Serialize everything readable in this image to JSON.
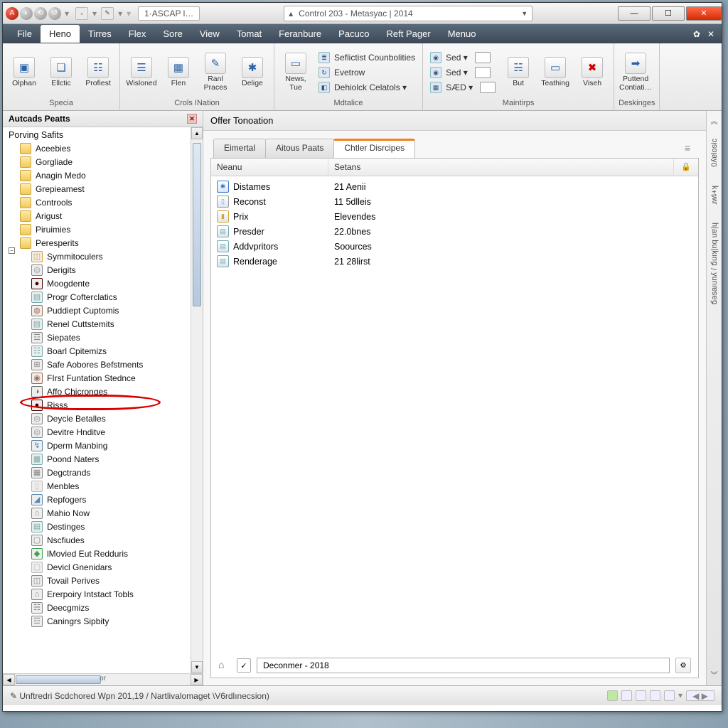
{
  "title_tab": "1·ASCAP l…",
  "combo_title": "Control 203 - Metasyac | 2014",
  "menubar": [
    "File",
    "Heno",
    "Tirres",
    "Flex",
    "Sore",
    "View",
    "Tomat",
    "Feranbure",
    "Pacuco",
    "Reft Pager",
    "Menuo"
  ],
  "menubar_active_index": 1,
  "ribbon_groups": [
    {
      "label": "Specia",
      "items": [
        {
          "l": "Olphan",
          "i": "▣"
        },
        {
          "l": "Ellctic",
          "i": "❏"
        },
        {
          "l": "Profiest",
          "i": "☷"
        }
      ]
    },
    {
      "label": "Crols INation",
      "items": [
        {
          "l": "Wisloned",
          "i": "☰"
        },
        {
          "l": "Flen",
          "i": "▦"
        },
        {
          "l": "Ranl Praces",
          "i": "✎"
        },
        {
          "l": "Delige",
          "i": "✱"
        }
      ]
    },
    {
      "label": "Mdtalice",
      "items": [
        {
          "l": "News,\nTue",
          "i": "▭"
        }
      ],
      "list": [
        {
          "l": "Seflictist Counbolities",
          "i": "≣"
        },
        {
          "l": "Evetrow",
          "i": "↻"
        },
        {
          "l": "Dehiolck Celatols ▾",
          "i": "◧"
        }
      ]
    },
    {
      "label": "Maintirps",
      "list2": [
        {
          "l": "Sed ▾",
          "i": "◉"
        },
        {
          "l": "Sed ▾",
          "i": "◉"
        },
        {
          "l": "SÆD ▾",
          "i": "▦"
        }
      ],
      "items": [
        {
          "l": "But",
          "i": "☵"
        },
        {
          "l": "Teathing",
          "i": "▭"
        },
        {
          "l": "Viseh",
          "i": "✖",
          "red": true
        }
      ]
    },
    {
      "label": "Deskinges",
      "items": [
        {
          "l": "Puttend\nContiati…",
          "i": "➡"
        }
      ]
    }
  ],
  "left_panel": {
    "title": "Autcads Peatts",
    "root": "Porving Safits",
    "folders": [
      "Aceebies",
      "Gorgliade",
      "Anagin Medo",
      "Grepieamest",
      "Controols",
      "Arigust",
      "Piruimies",
      "Peresperits"
    ],
    "subitems": [
      {
        "l": "Symmitoculers",
        "i": "◫",
        "c": "#d8a030"
      },
      {
        "l": "Derigits",
        "i": "◎",
        "c": "#888"
      },
      {
        "l": "Moogdente",
        "i": "●",
        "c": "#400"
      },
      {
        "l": "Progr Cofterclatics",
        "i": "▤",
        "c": "#7aa"
      },
      {
        "l": "Puddiept Cuptomis",
        "i": "◍",
        "c": "#a07050"
      },
      {
        "l": "Renel Cuttstemits",
        "i": "▤",
        "c": "#7aa"
      },
      {
        "l": "Siepates",
        "i": "☲",
        "c": "#888"
      },
      {
        "l": "Boarl Cpitemizs",
        "i": "☷",
        "c": "#7aa"
      },
      {
        "l": "Safe Aobores Befstments",
        "i": "⊞",
        "c": "#888"
      },
      {
        "l": "FIrst Funtation Stednce",
        "i": "◉",
        "c": "#a07050"
      },
      {
        "l": "Affo Chicronges",
        "i": "◑",
        "c": "#666"
      },
      {
        "l": "Risss",
        "i": "●",
        "c": "#400"
      },
      {
        "l": "Deycle Betalles",
        "i": "◎",
        "c": "#888"
      },
      {
        "l": "Devitre Hnditve",
        "i": "◎",
        "c": "#888"
      },
      {
        "l": "Dperm Manbing",
        "i": "↯",
        "c": "#5a88b0"
      },
      {
        "l": "Poond Naters",
        "i": "▦",
        "c": "#7aa"
      },
      {
        "l": "Degctrands",
        "i": "▦",
        "c": "#888"
      },
      {
        "l": "Menbles",
        "i": "▯",
        "c": "#bbb"
      },
      {
        "l": "Repfogers",
        "i": "◢",
        "c": "#5a88b0"
      },
      {
        "l": "Mahio Now",
        "i": "⌂",
        "c": "#888"
      },
      {
        "l": "Destinges",
        "i": "▤",
        "c": "#7aa"
      },
      {
        "l": "Nscfiudes",
        "i": "▢",
        "c": "#888"
      },
      {
        "l": "lMovied Eut Redduris",
        "i": "◆",
        "c": "#42a050"
      },
      {
        "l": "Devicl Gnenidars",
        "i": "▢",
        "c": "#bbb"
      },
      {
        "l": "Tovail Perives",
        "i": "◫",
        "c": "#888"
      },
      {
        "l": "Ererpoiry Intstact Tobls",
        "i": "⌂",
        "c": "#888"
      },
      {
        "l": "Deecgmizs",
        "i": "☵",
        "c": "#888"
      },
      {
        "l": "Caningrs Sipbity",
        "i": "☲",
        "c": "#888"
      }
    ],
    "hscroll_label": "or"
  },
  "main_header": "Offer Tonoation",
  "tabs": [
    {
      "l": "Eimertal"
    },
    {
      "l": "Aitous Paats"
    },
    {
      "l": "Chtler Disrcipes",
      "active": true
    }
  ],
  "columns": [
    "Neanu",
    "Setans"
  ],
  "rows": [
    {
      "n": "Distames",
      "v": "21 Aenii",
      "i": "✱",
      "c": "#3a78c8"
    },
    {
      "n": "Reconst",
      "v": "11 5dlleis",
      "i": "▯",
      "c": "#999"
    },
    {
      "n": "Prix",
      "v": "Elevendes",
      "i": "▮",
      "c": "#d8a030"
    },
    {
      "n": "Presder",
      "v": "22.0bnes",
      "i": "▤",
      "c": "#7aa"
    },
    {
      "n": "Addvpritors",
      "v": "Soources",
      "i": "▤",
      "c": "#7aa"
    },
    {
      "n": "Renderage",
      "v": "21 28lirst",
      "i": "▤",
      "c": "#7aa"
    }
  ],
  "footer_value": "Deconmer - 2018",
  "right_tabs": [
    "0ʎɐlosic",
    "ɹwʇ+ʞ",
    "ճǝsaıunʎ / ճuıʞ|nq uɐ|ɥ"
  ],
  "statusbar": "✎ Unftredri Scdchored Wpn 201,19 / Nartlivalomaget  \\V6rdlınecsion)"
}
